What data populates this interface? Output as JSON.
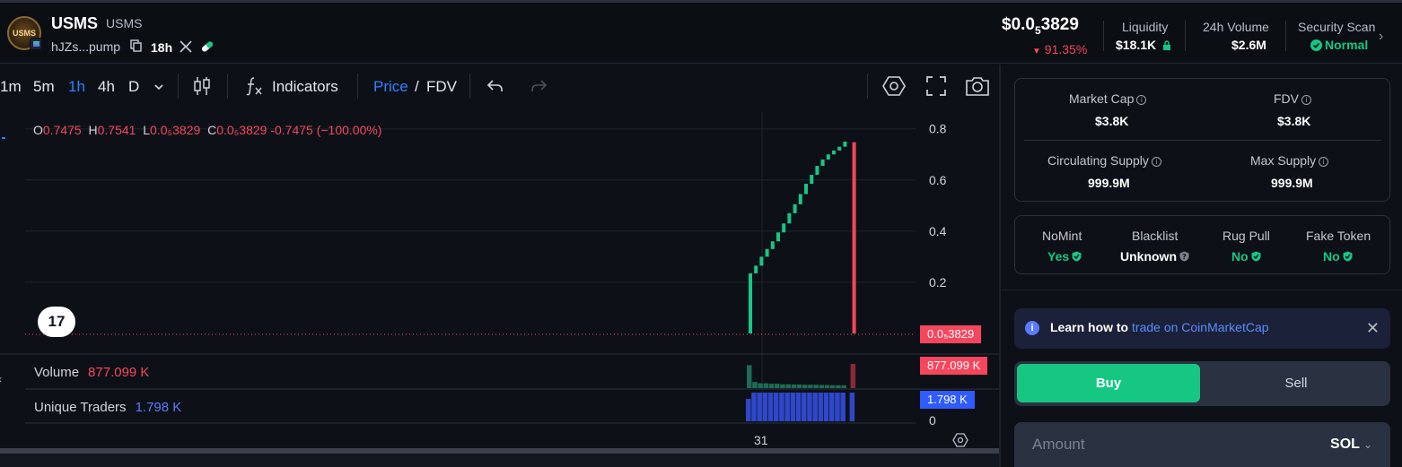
{
  "token": {
    "logo_text": "USMS",
    "name": "USMS",
    "symbol": "USMS",
    "address_short": "hJZs...pump",
    "age": "18h"
  },
  "header": {
    "price_prefix": "$0.0",
    "price_sub": "5",
    "price_rest": "3829",
    "change": "91.35%",
    "liquidity_label": "Liquidity",
    "liquidity_value": "$18.1K",
    "volume_label": "24h Volume",
    "volume_value": "$2.6M",
    "security_label": "Security Scan",
    "security_value": "Normal",
    "colors": {
      "up": "#16c784",
      "down": "#f6465d",
      "accent": "#2f80ff"
    }
  },
  "toolbar": {
    "timeframes": [
      "1m",
      "5m",
      "1h",
      "4h",
      "D"
    ],
    "active_timeframe": "1h",
    "indicators_label": "Indicators",
    "price_label": "Price",
    "slash": "/",
    "fdv_label": "FDV"
  },
  "chart": {
    "ohlc": {
      "o_label": "O",
      "o": "0.7475",
      "h_label": "H",
      "h": "0.7541",
      "l_label": "L",
      "l": "0.0₅3829",
      "c_label": "C",
      "c": "0.0₅3829",
      "change": "-0.7475 (−100.00%)"
    },
    "tv_logo": "17",
    "volume_label": "Volume",
    "volume_value": "877.099 K",
    "volume_tag": "877.099 K",
    "traders_label": "Unique Traders",
    "traders_value": "1.798 K",
    "traders_tag": "1.798 K",
    "price_tag": "0.0₅3829",
    "traders_axis_zero": "0",
    "x_tick": "31"
  },
  "chart_data": {
    "type": "candlestick",
    "y_ticks": [
      "0.8",
      "0.6",
      "0.4",
      "0.2"
    ],
    "ylim": [
      0,
      0.82
    ],
    "candles": [
      {
        "o": 0.0,
        "c": 0.235,
        "up": true
      },
      {
        "o": 0.235,
        "c": 0.265,
        "up": true
      },
      {
        "o": 0.265,
        "c": 0.3,
        "up": true
      },
      {
        "o": 0.3,
        "c": 0.33,
        "up": true
      },
      {
        "o": 0.33,
        "c": 0.36,
        "up": true
      },
      {
        "o": 0.36,
        "c": 0.395,
        "up": true
      },
      {
        "o": 0.395,
        "c": 0.43,
        "up": true
      },
      {
        "o": 0.43,
        "c": 0.47,
        "up": true
      },
      {
        "o": 0.47,
        "c": 0.505,
        "up": true
      },
      {
        "o": 0.505,
        "c": 0.545,
        "up": true
      },
      {
        "o": 0.545,
        "c": 0.585,
        "up": true
      },
      {
        "o": 0.585,
        "c": 0.62,
        "up": true
      },
      {
        "o": 0.62,
        "c": 0.655,
        "up": true
      },
      {
        "o": 0.655,
        "c": 0.68,
        "up": true
      },
      {
        "o": 0.68,
        "c": 0.7,
        "up": true
      },
      {
        "o": 0.7,
        "c": 0.715,
        "up": true
      },
      {
        "o": 0.715,
        "c": 0.73,
        "up": true
      },
      {
        "o": 0.73,
        "c": 0.75,
        "up": true
      },
      {
        "o": 0.7475,
        "c": 0.0,
        "up": false
      }
    ],
    "volume_rel": [
      0.95,
      0.25,
      0.2,
      0.2,
      0.18,
      0.18,
      0.16,
      0.16,
      0.15,
      0.15,
      0.14,
      0.14,
      0.14,
      0.13,
      0.13,
      0.12,
      0.12,
      0.12,
      1.0
    ],
    "traders_rel": [
      0.78,
      1.0,
      1.0,
      1.0,
      1.0,
      1.0,
      1.0,
      1.0,
      1.0,
      1.0,
      1.0,
      1.0,
      1.0,
      1.0,
      1.0,
      1.0,
      1.0,
      1.0,
      1.0
    ]
  },
  "stats": {
    "market_cap_label": "Market Cap",
    "market_cap_value": "$3.8K",
    "fdv_label": "FDV",
    "fdv_value": "$3.8K",
    "circ_label": "Circulating Supply",
    "circ_value": "999.9M",
    "max_label": "Max Supply",
    "max_value": "999.9M"
  },
  "security": {
    "nomint_label": "NoMint",
    "nomint_value": "Yes",
    "blacklist_label": "Blacklist",
    "blacklist_value": "Unknown",
    "rugpull_label": "Rug Pull",
    "rugpull_value": "No",
    "fake_label": "Fake Token",
    "fake_value": "No"
  },
  "learn": {
    "text": "Learn how to",
    "link": "trade on CoinMarketCap"
  },
  "trade": {
    "buy_label": "Buy",
    "sell_label": "Sell",
    "amount_placeholder": "Amount",
    "currency": "SOL"
  }
}
